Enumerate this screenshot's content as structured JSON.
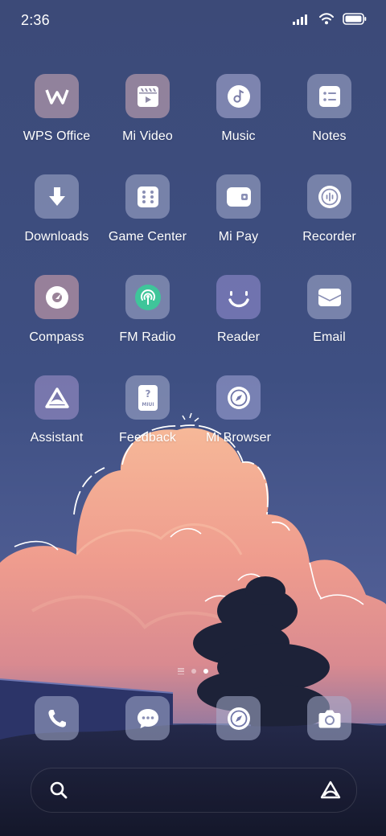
{
  "status_bar": {
    "time": "2:36",
    "icons": [
      "signal-icon",
      "wifi-icon",
      "battery-icon"
    ]
  },
  "apps": [
    {
      "label": "WPS Office",
      "icon": "wps-office-icon"
    },
    {
      "label": "Mi Video",
      "icon": "mi-video-icon"
    },
    {
      "label": "Music",
      "icon": "music-icon"
    },
    {
      "label": "Notes",
      "icon": "notes-icon"
    },
    {
      "label": "Downloads",
      "icon": "downloads-icon"
    },
    {
      "label": "Game Center",
      "icon": "game-center-icon"
    },
    {
      "label": "Mi Pay",
      "icon": "mi-pay-icon"
    },
    {
      "label": "Recorder",
      "icon": "recorder-icon"
    },
    {
      "label": "Compass",
      "icon": "compass-icon"
    },
    {
      "label": "FM Radio",
      "icon": "fm-radio-icon"
    },
    {
      "label": "Reader",
      "icon": "reader-icon"
    },
    {
      "label": "Email",
      "icon": "email-icon"
    },
    {
      "label": "Assistant",
      "icon": "assistant-icon"
    },
    {
      "label": "Feedback",
      "icon": "feedback-icon"
    },
    {
      "label": "Mi Browser",
      "icon": "mi-browser-icon"
    }
  ],
  "feedback_icon_text": "MIUI",
  "page_indicator": {
    "pages": 2,
    "active_page": 2
  },
  "dock": [
    {
      "icon": "phone-icon"
    },
    {
      "icon": "messages-icon"
    },
    {
      "icon": "browser-icon"
    },
    {
      "icon": "camera-icon"
    }
  ],
  "search_bar": {
    "left_icon": "search-icon",
    "right_icon": "assistant-icon"
  }
}
